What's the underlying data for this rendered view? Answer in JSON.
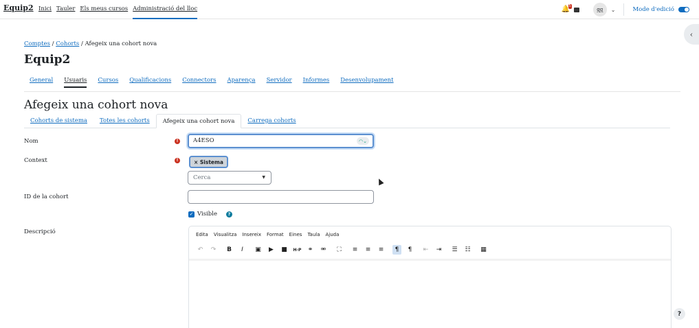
{
  "topnav": {
    "brand": "Equip2",
    "items": [
      "Inici",
      "Tauler",
      "Els meus cursos",
      "Administració del lloc"
    ],
    "notification_count": "5",
    "avatar_initials": "gg",
    "edit_mode_label": "Mode d'edició"
  },
  "breadcrumb": {
    "part1": "Comptes",
    "sep": "/",
    "part2": "Cohorts",
    "current": "Afegeix una cohort nova"
  },
  "page_title": "Equip2",
  "section_tabs": [
    "General",
    "Usuaris",
    "Cursos",
    "Qualificacions",
    "Connectors",
    "Aparença",
    "Servidor",
    "Informes",
    "Desenvolupament"
  ],
  "heading": "Afegeix una cohort nova",
  "sub_tabs": [
    "Cohorts de sistema",
    "Totes les cohorts",
    "Afegeix una cohort nova",
    "Carrega cohorts"
  ],
  "form": {
    "nom_label": "Nom",
    "nom_value": "A4ESO",
    "context_label": "Context",
    "context_chip": "× Sistema",
    "context_search_placeholder": "Cerca",
    "id_label": "ID de la cohort",
    "id_value": "",
    "visible_label": "Visible",
    "desc_label": "Descripció"
  },
  "editor": {
    "menu": [
      "Edita",
      "Visualitza",
      "Insereix",
      "Format",
      "Eines",
      "Taula",
      "Ajuda"
    ]
  },
  "help_button": "?"
}
